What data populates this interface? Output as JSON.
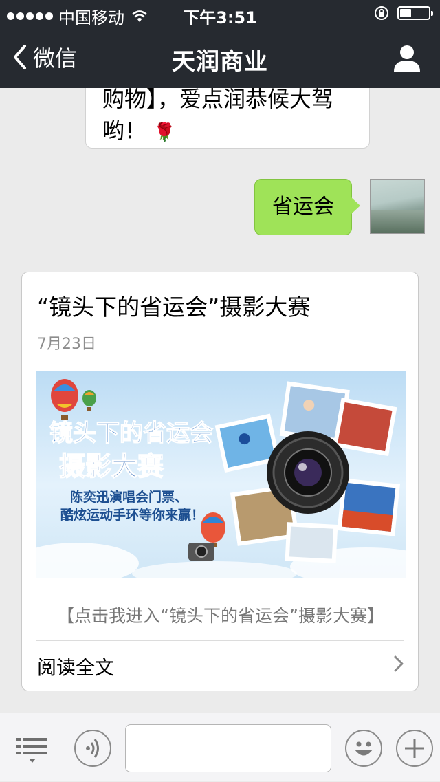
{
  "status_bar": {
    "carrier": "中国移动",
    "time": "下午3:51",
    "signal_icon": "signal-dots-icon",
    "wifi_icon": "wifi-icon",
    "battery_level": 0.4
  },
  "nav": {
    "back_label": "微信",
    "title": "天润商业"
  },
  "messages": {
    "incoming_text_line1": "购物】，爱点润恭候大驾",
    "incoming_text_line2": "哟！",
    "incoming_emoji": "🌹",
    "sent_text": "省运会"
  },
  "article": {
    "title": "“镜头下的省运会”摄影大赛",
    "date": "7月23日",
    "banner": {
      "title_line1": "镜头下的省运会",
      "title_line2": "摄影大赛",
      "subtitle_line1": "陈奕迅演唱会门票、",
      "subtitle_line2": "酷炫运动手环等你来赢！"
    },
    "link_text": "【点击我进入“镜头下的省运会”摄影大赛】",
    "read_more": "阅读全文"
  },
  "input_bar": {
    "placeholder": ""
  },
  "colors": {
    "nav_bg": "#262a30",
    "sent_bubble": "#9fe358",
    "chat_bg": "#ebebeb",
    "banner_title": "#2b6fc2",
    "banner_subtitle": "#1d4f91"
  }
}
